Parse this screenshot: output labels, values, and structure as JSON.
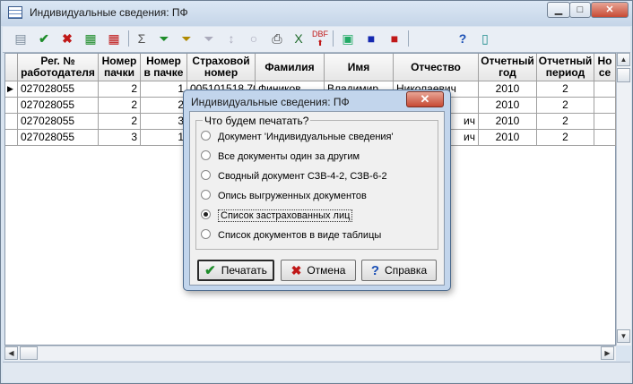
{
  "window": {
    "title": "Индивидуальные сведения: ПФ"
  },
  "titlebar_buttons": {
    "minimize": "▁",
    "maximize": "□",
    "close": "✕"
  },
  "grid": {
    "columns": [
      "Рег. №\nработодателя",
      "Номер\nпачки",
      "Номер\nв пачке",
      "Страховой\nномер",
      "Фамилия",
      "Имя",
      "Отчество",
      "Отчетный\nгод",
      "Отчетный\nпериод",
      "Но\nсе"
    ],
    "rows": [
      {
        "reg": "027028055",
        "pack": "2",
        "num": "1",
        "snils": "005101518 70",
        "fam": "Фиников",
        "name": "Владимир",
        "otch": "Николаевич",
        "year": "2010",
        "period": "2"
      },
      {
        "reg": "027028055",
        "pack": "2",
        "num": "2",
        "snils": "",
        "fam": "",
        "name": "",
        "otch": "",
        "year": "2010",
        "period": "2"
      },
      {
        "reg": "027028055",
        "pack": "2",
        "num": "3",
        "snils": "",
        "fam": "",
        "name": "",
        "otch": "ич",
        "year": "2010",
        "period": "2"
      },
      {
        "reg": "027028055",
        "pack": "3",
        "num": "1",
        "snils": "",
        "fam": "",
        "name": "",
        "otch": "ич",
        "year": "2010",
        "period": "2"
      }
    ]
  },
  "dialog": {
    "title": "Индивидуальные сведения: ПФ",
    "close": "✕",
    "group_label": "Что будем печатать?",
    "options": [
      "Документ 'Индивидуальные сведения'",
      "Все документы один за другим",
      "Сводный документ СЗВ-4-2, СЗВ-6-2",
      "Опись выгруженных документов",
      "Список застрахованных лиц",
      "Список документов в виде таблицы"
    ],
    "selected_index": 4,
    "buttons": {
      "print": "Печатать",
      "cancel": "Отмена",
      "help": "Справка"
    }
  },
  "icons": {
    "print": "✔",
    "cancel": "✖",
    "help": "?"
  },
  "colors": {
    "ok_green": "#1e8c2a",
    "cancel_red": "#c01818",
    "help_blue": "#1a4fb5"
  }
}
